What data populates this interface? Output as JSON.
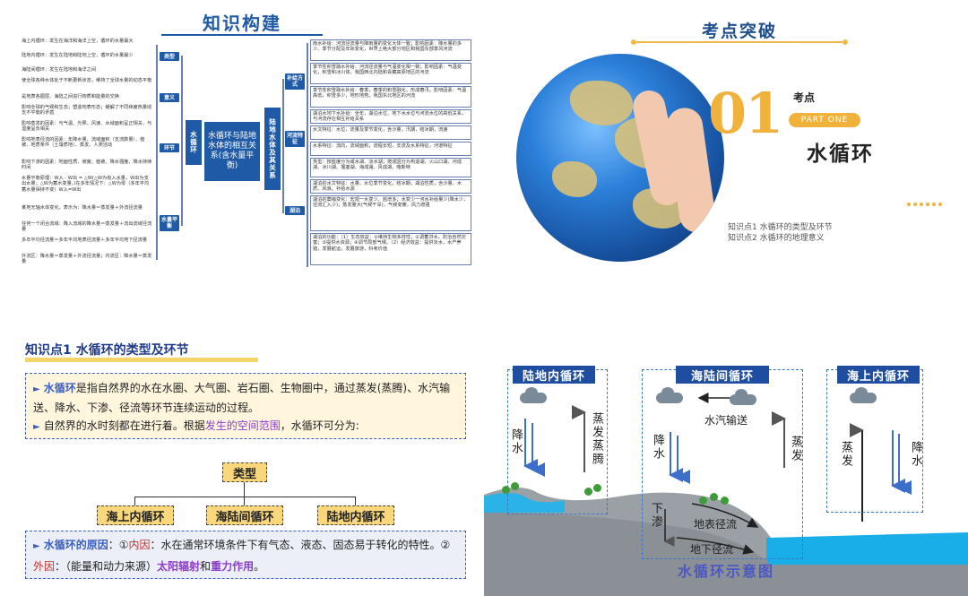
{
  "mindmap": {
    "title": "知识构建",
    "center": "水循环与陆地水体的相互关系(含水量平衡)",
    "left_root": "水循环",
    "right_root": "陆地水体及其关系",
    "tags": [
      "类型",
      "意义",
      "环节",
      "水量平衡"
    ],
    "right_tags": [
      "补给方式",
      "河流特征",
      "湖泊"
    ],
    "left_items": [
      "海上内循环：发生在海洋和海洋上空，循环的水量最大",
      "陆地内循环：发生在陆地和陆地上空，循环的水量最少",
      "海陆间循环：发生在陆地和海洋之间",
      "使全球各种水体处于不断更新状态，维持了全球水量的动态平衡",
      "是地表各圈层、海陆之间进行物质和能量的交换",
      "影响全球的气候和生态；塑造地表形态；缓解了不同纬度热量收支不平衡的矛盾",
      "影响蒸发的因素：与气温、光照、风速、水域面积呈正相关，与湿度呈负相关",
      "影响地表径流的因素：年降水量、流域面积（支流数量）、植被、地质条件（土壤质地）、蒸发、人类活动",
      "影响下渗的因素：地面性质、坡度、植被、降水强度、降水持续时间",
      "水量平衡原理：W入 - W出 = △W(△W为有入水量，W出为支出水量；△W为蓄水变量。)在多年情况下：△W为零（多年平均蓄水量保持不变）W入=W出",
      "某地无轴水体变化，表示为：降水量＝蒸发量＋外流径流量",
      "任何一个闭合流域：降入流域的降水量＝蒸发量＋流出流域径流量",
      "多年平均径流量＝多年平均地表径流量＋多年平均地下径流量",
      "外流区：降水量＝蒸发量＋外流径流量；内流区：降水量＝蒸发量"
    ],
    "right_items": [
      "雨水补给：河流径流量与降雨量的变化大体一致；影响因素：降水量的多少、季节分配及年际变化，世界上绝大部分地区和我国东部季风河流",
      "季节性积雪融水补给：河流径流量与气温变化相一致；影响因素：气温变化，积雪和冰川体。我国西北内陆和青藏高原地区的河流",
      "季节性积雪融水补给：春季，春季的积雪融化，形成春汛。影响因素：气温高低，积雪多少，地形地势。我国东北地区的河流",
      "湖泊水地下水补给：全年，湖泊水位、地下水水位与河流水位的高低关系，与河流存在相互补给关系",
      "水文特征：水位，流量及季节变化，含沙量，汛期，结冰期，流速",
      "水系特征：流向，流域面积，流程长短，支流及水系特征，河道特征",
      "类型：按盐度分为咸水湖、淡水湖；按成因分为构造湖、火山口湖、河成湖、冰川湖、堰塞湖、海成湖、风成湖、喀斯特",
      "湖泊的水文特征：水量、水位季节变化，结冰期，湖泊性质，含沙量、水质、风浪、补给水源",
      "湖泊的萎缩变化：宏观一水变少、盐增多；水变少一河水补给量少(降水少，径流汇入少)；蒸发量大(气候干旱)，气候变暖，风力增强",
      "湖泊的功能：（1）生态效益：①维持生物多样性；②调蓄洪水，防治自然灾害；③提供水资源；④调节局部气候。（2）经济效益：提供淡水，水产养殖，发展航运，发展旅游，科考价值"
    ]
  },
  "cover": {
    "header": "考点突破",
    "number": "01",
    "label": "考点",
    "part": "PART ONE",
    "title": "水循环",
    "points": [
      "知识点1 水循环的类型及环节",
      "知识点2 水循环的地理意义"
    ]
  },
  "knowledge": {
    "heading": "知识点1  水循环的类型及环节",
    "def_term": "水循环",
    "def_rest": "是指自然界的水在水圈、大气圈、岩石圈、生物圈中，通过蒸发(蒸腾)、水汽输送、降水、下渗、径流等环节连续运动的过程。",
    "def2_a": "自然界的水时刻都在进行着。根据",
    "def2_kw": "发生的空间范围",
    "def2_b": "，水循环可分为:",
    "type_root": "类型",
    "types": [
      "海上内循环",
      "海陆间循环",
      "陆地内循环"
    ],
    "cause_term": "水循环的原因",
    "cause_a": "：①",
    "inner_label": "内因",
    "cause_b": "：水在通常环境条件下有气态、液态、固态易于转化的特性。②",
    "outer_label": "外因",
    "cause_c": "：（能量和动力来源）",
    "solar": "太阳辐射",
    "and": "和",
    "gravity": "重力作用",
    "end": "。"
  },
  "diagram": {
    "title": "水循环示意图",
    "labels": [
      "陆地内循环",
      "海陆间循环",
      "海上内循环"
    ],
    "land_rain": "降水",
    "land_evap": "蒸发蒸腾",
    "vapor": "水汽输送",
    "mid_rain": "降水",
    "mid_evap": "蒸发",
    "infiltrate": "下渗",
    "surface": "地表径流",
    "ground": "地下径流",
    "sea_evap": "蒸发",
    "sea_rain": "降水"
  }
}
